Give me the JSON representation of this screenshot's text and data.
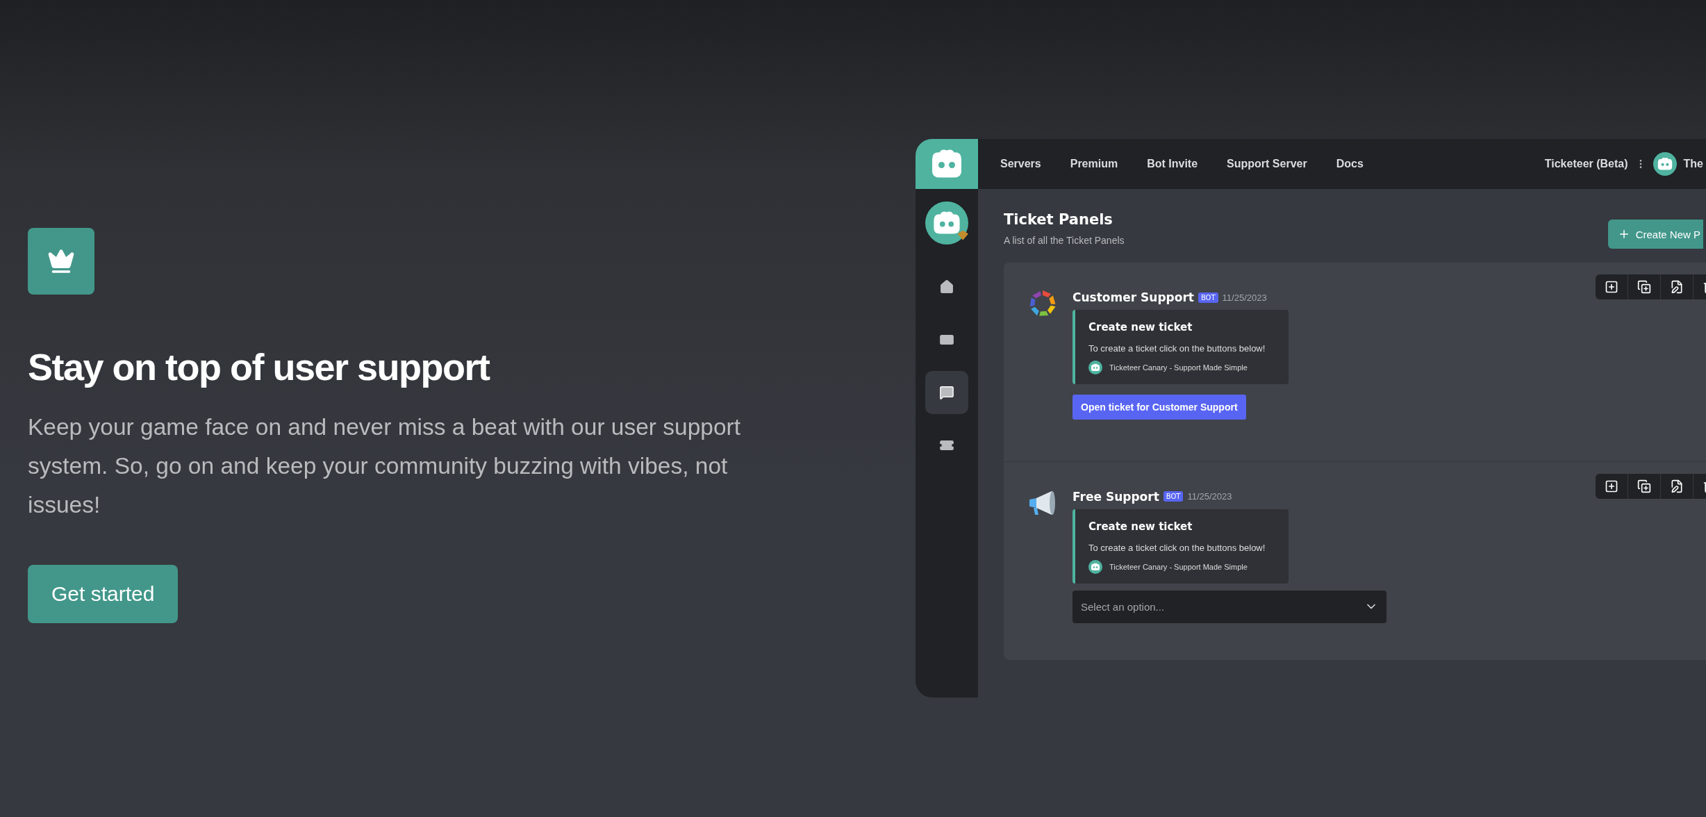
{
  "hero": {
    "title": "Stay on top of user support",
    "description": "Keep your game face on and never miss a beat with our user support system. So, go on and keep your community buzzing with vibes, not issues!",
    "button": "Get started"
  },
  "app": {
    "nav": [
      "Servers",
      "Premium",
      "Bot Invite",
      "Support Server",
      "Docs"
    ],
    "account": {
      "server": "Ticketeer (Beta)",
      "user": "The"
    },
    "sidebar": [
      {
        "kind": "home",
        "selected": false
      },
      {
        "kind": "card",
        "selected": false
      },
      {
        "kind": "chat",
        "selected": true
      },
      {
        "kind": "ticket",
        "selected": false
      }
    ],
    "page": {
      "title": "Ticket Panels",
      "subtitle": "A list of all the Ticket Panels",
      "create_button": "Create New P"
    },
    "panels": [
      {
        "kind": "ring",
        "name": "Customer Support",
        "badge": "BOT",
        "date": "11/25/2023",
        "embed": {
          "title": "Create new ticket",
          "description": "To create a ticket click on the buttons below!",
          "footer": "Ticketeer Canary - Support Made Simple"
        },
        "component": {
          "kind": "button",
          "text": "Open ticket for Customer Support"
        }
      },
      {
        "kind": "megaphone",
        "name": "Free Support",
        "badge": "BOT",
        "date": "11/25/2023",
        "embed": {
          "title": "Create new ticket",
          "description": "To create a ticket click on the buttons below!",
          "footer": "Ticketeer Canary - Support Made Simple"
        },
        "component": {
          "kind": "select",
          "text": "Select an option..."
        }
      }
    ]
  }
}
